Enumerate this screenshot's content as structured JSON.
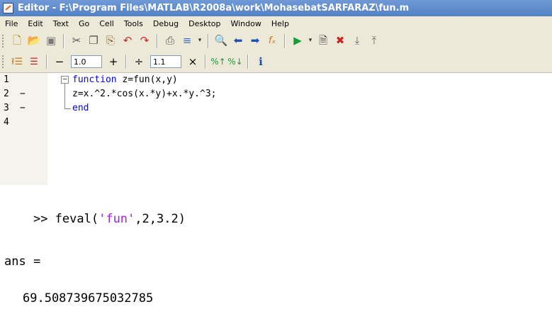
{
  "window": {
    "title": "Editor - F:\\Program Files\\MATLAB\\R2008a\\work\\MohasebatSARFARAZ\\fun.m"
  },
  "menu": [
    "File",
    "Edit",
    "Text",
    "Go",
    "Cell",
    "Tools",
    "Debug",
    "Desktop",
    "Window",
    "Help"
  ],
  "toolbar": {
    "icons": [
      "new-file-icon",
      "open-folder-icon",
      "save-icon",
      "cut-icon",
      "copy-icon",
      "paste-icon",
      "undo-icon",
      "redo-icon",
      "print-icon",
      "comment-icon",
      "find-icon",
      "back-icon",
      "forward-icon",
      "function-icon",
      "run-icon",
      "breakpoint-set-icon",
      "breakpoint-clear-icon",
      "step-icon"
    ],
    "cell": {
      "minus": "−",
      "increment_value": "1.0",
      "plus": "+",
      "divide": "÷",
      "scale_value": "1.1",
      "times": "×"
    }
  },
  "editor": {
    "lines": [
      {
        "num": "1",
        "dash": "",
        "parts": [
          {
            "text": "function",
            "kw": true
          },
          {
            "text": " z=fun(x,y)",
            "kw": false
          }
        ]
      },
      {
        "num": "2",
        "dash": "−",
        "parts": [
          {
            "text": "z=x.^2.*cos(x.*y)+x.*y.^3;",
            "kw": false
          }
        ]
      },
      {
        "num": "3",
        "dash": "−",
        "parts": [
          {
            "text": "end",
            "kw": true
          }
        ]
      },
      {
        "num": "4",
        "dash": "",
        "parts": []
      }
    ]
  },
  "command": {
    "prompt": ">> ",
    "call_prefix": "feval(",
    "call_string": "'fun'",
    "call_suffix": ",2,3.2)",
    "ans_label": "ans =",
    "result": "69.508739675032785"
  },
  "colors": {
    "keyword": "#0000ff",
    "string": "#a020f0",
    "titlebar": "#5a86c8",
    "chrome": "#ece9d8"
  }
}
